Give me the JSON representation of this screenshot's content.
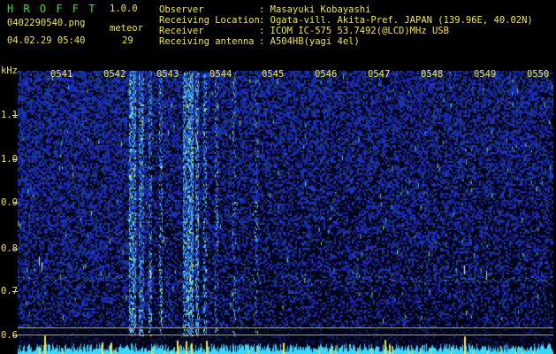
{
  "app": {
    "name": "H R O F F T",
    "version": "1.0.0"
  },
  "file": {
    "name": "0402290540.png",
    "datetime": "04.02.29 05:40"
  },
  "meteor": {
    "label": "meteor",
    "count": "29"
  },
  "info": {
    "observer_label": "Observer",
    "observer_value": ": Masayuki Kobayashi",
    "location_label": "Receiving Location",
    "location_value": ": Ogata-vill. Akita-Pref. JAPAN (139.96E, 40.02N)",
    "receiver_label": "Receiver",
    "receiver_value": ": ICOM IC-575 53.7492(@LCD)MHz USB",
    "antenna_label": "Receiving antenna",
    "antenna_value": ": A504HB(yagi 4el)"
  },
  "axis": {
    "unit": "kHz",
    "time_ticks": [
      "0541",
      "0542",
      "0543",
      "0544",
      "0545",
      "0546",
      "0547",
      "0548",
      "0549",
      "0550"
    ],
    "freq_ticks": [
      "1.1",
      "1.0",
      "0.9",
      "0.8",
      "0.7",
      "0.6"
    ]
  },
  "colors": {
    "label": "#f2e64a",
    "title": "#33e233",
    "background": "#000000",
    "noise": "#1a2aa0",
    "echo": "#4fe0ff"
  }
}
